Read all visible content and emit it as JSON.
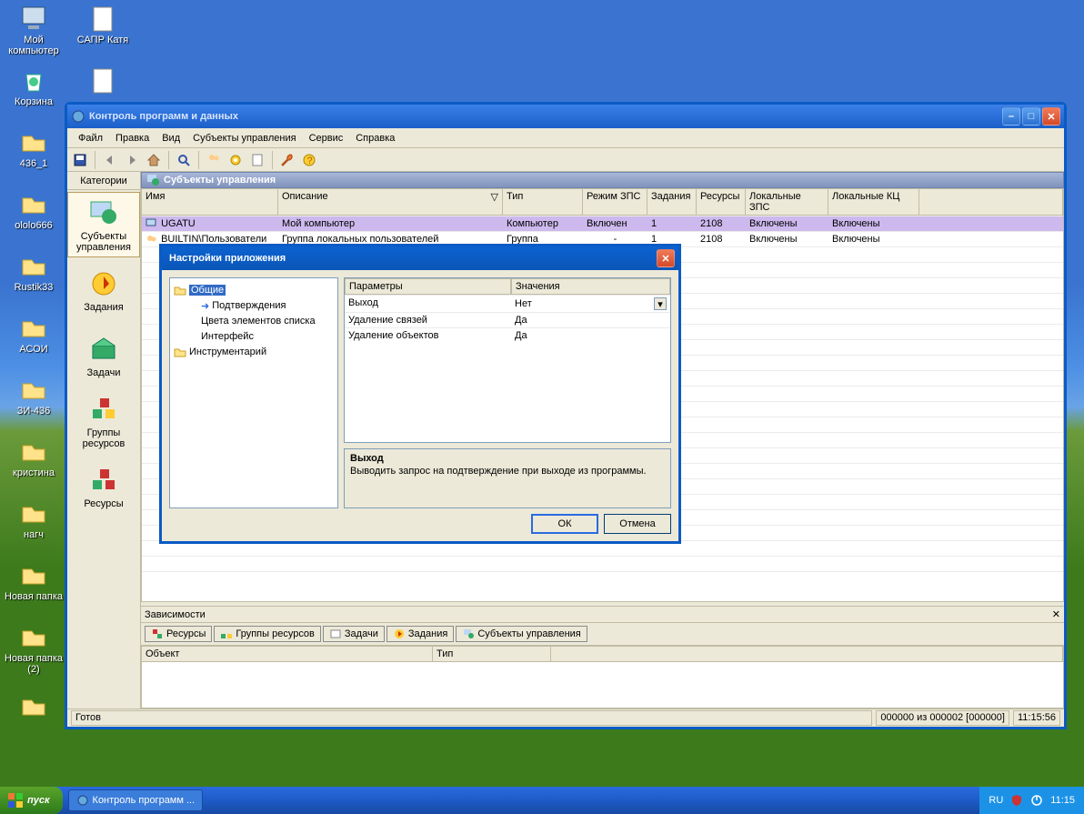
{
  "desktop": {
    "icons": [
      {
        "label": "Мой\nкомпьютер"
      },
      {
        "label": "САПР Катя"
      },
      {
        "label": "Корзина"
      },
      {
        "label": "436_1"
      },
      {
        "label": "ololo666"
      },
      {
        "label": "Rustik33"
      },
      {
        "label": "АСОИ"
      },
      {
        "label": "ЗИ-436"
      },
      {
        "label": "кристина"
      },
      {
        "label": "нагч"
      },
      {
        "label": "Новая папка"
      },
      {
        "label": "Новая папка\n(2)"
      }
    ]
  },
  "taskbar": {
    "start": "пуск",
    "app_button": "Контроль программ ...",
    "lang": "RU",
    "time": "11:15"
  },
  "window": {
    "title": "Контроль программ и данных",
    "menu": [
      "Файл",
      "Правка",
      "Вид",
      "Субъекты управления",
      "Сервис",
      "Справка"
    ],
    "categories_hdr": "Категории",
    "categories": [
      "Субъекты управления",
      "Задания",
      "Задачи",
      "Группы ресурсов",
      "Ресурсы"
    ],
    "pane_title": "Субъекты управления",
    "columns": [
      "Имя",
      "Описание",
      "Тип",
      "Режим ЗПС",
      "Задания",
      "Ресурсы",
      "Локальные ЗПС",
      "Локальные КЦ"
    ],
    "rows": [
      {
        "name": "UGATU",
        "desc": "Мой компьютер",
        "type": "Компьютер",
        "zps": "Включен",
        "tasks": "1",
        "res": "2108",
        "lzps": "Включены",
        "lkc": "Включены"
      },
      {
        "name": "BUILTIN\\Пользователи",
        "desc": "Группа локальных пользователей",
        "type": "Группа",
        "zps": "-",
        "tasks": "1",
        "res": "2108",
        "lzps": "Включены",
        "lkc": "Включены"
      }
    ],
    "dep_title": "Зависимости",
    "dep_tabs": [
      "Ресурсы",
      "Группы ресурсов",
      "Задачи",
      "Задания",
      "Субъекты управления"
    ],
    "dep_cols": [
      "Объект",
      "Тип"
    ],
    "status_ready": "Готов",
    "status_count": "000000 из 000002 [000000]",
    "status_time": "11:15:56"
  },
  "dialog": {
    "title": "Настройки приложения",
    "tree": {
      "n0": "Общие",
      "n1": "Подтверждения",
      "n2": "Цвета элементов списка",
      "n3": "Интерфейс",
      "n4": "Инструментарий"
    },
    "param_header": [
      "Параметры",
      "Значения"
    ],
    "params": [
      {
        "name": "Выход",
        "value": "Нет",
        "dd": true
      },
      {
        "name": "Удаление связей",
        "value": "Да"
      },
      {
        "name": "Удаление объектов",
        "value": "Да"
      }
    ],
    "desc_title": "Выход",
    "desc_body": "Выводить запрос на подтверждение при выходе из программы.",
    "ok": "ОК",
    "cancel": "Отмена"
  }
}
